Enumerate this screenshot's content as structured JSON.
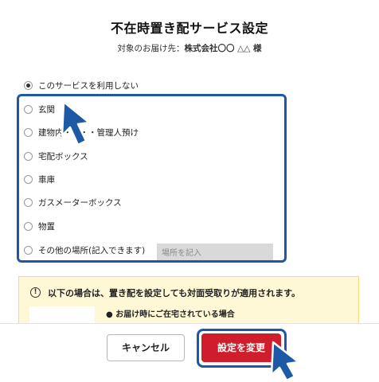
{
  "title": "不在時置き配サービス設定",
  "destination": {
    "prefix": "対象のお届け先：",
    "name": "株式会社〇〇 △△ 様"
  },
  "options": [
    {
      "label": "このサービスを利用しない",
      "checked": true
    },
    {
      "label": "玄関",
      "checked": false
    },
    {
      "label": "建物内・・・・管理人預け",
      "checked": false
    },
    {
      "label": "宅配ボックス",
      "checked": false
    },
    {
      "label": "車庫",
      "checked": false
    },
    {
      "label": "ガスメーターボックス",
      "checked": false
    },
    {
      "label": "物置",
      "checked": false
    },
    {
      "label": "その他の場所(記入できます)",
      "checked": false
    }
  ],
  "other_place_input": {
    "placeholder": "場所を記入",
    "value": ""
  },
  "notice": {
    "icon": "exclamation-circle-icon",
    "text": "以下の場合は、置き配を設定しても対面受取りが適用されます。",
    "bullets": [
      "● お届け時にご在宅されている場合"
    ]
  },
  "buttons": {
    "cancel": "キャンセル",
    "submit": "設定を変更"
  },
  "colors": {
    "highlight": "#1c5aa6",
    "submit_bg": "#d01d2b",
    "notice_bg": "#fff8d6"
  }
}
